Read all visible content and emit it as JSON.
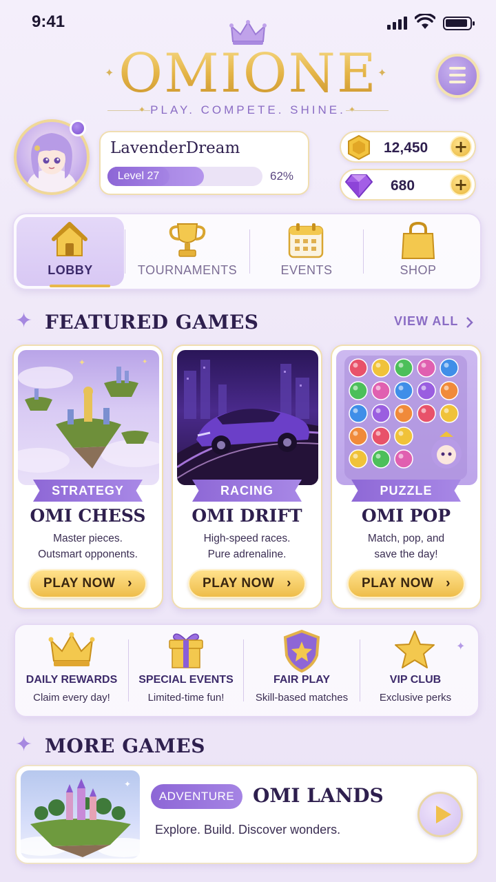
{
  "status_bar": {
    "time": "9:41"
  },
  "header": {
    "logo": "OMIONE",
    "tagline": "PLAY. COMPETE. SHINE.",
    "menu_icon": "hamburger-menu-icon"
  },
  "profile": {
    "username": "LavenderDream",
    "level_label": "Level 27",
    "progress_percent": 62,
    "progress_label": "62%"
  },
  "currency": {
    "coins": {
      "icon": "gold-coin-icon",
      "value": "12,450",
      "add": "+"
    },
    "gems": {
      "icon": "purple-gem-icon",
      "value": "680",
      "add": "+"
    }
  },
  "nav": {
    "items": [
      {
        "label": "LOBBY",
        "icon": "house-icon",
        "active": true
      },
      {
        "label": "TOURNAMENTS",
        "icon": "trophy-icon",
        "active": false
      },
      {
        "label": "EVENTS",
        "icon": "calendar-icon",
        "active": false
      },
      {
        "label": "SHOP",
        "icon": "shopping-bag-icon",
        "active": false
      }
    ]
  },
  "featured": {
    "title": "FEATURED GAMES",
    "view_all": "VIEW ALL",
    "games": [
      {
        "genre": "STRATEGY",
        "name": "OMI CHESS",
        "desc1": "Master pieces.",
        "desc2": "Outsmart opponents.",
        "cta": "PLAY NOW"
      },
      {
        "genre": "RACING",
        "name": "OMI DRIFT",
        "desc1": "High-speed races.",
        "desc2": "Pure adrenaline.",
        "cta": "PLAY NOW"
      },
      {
        "genre": "PUZZLE",
        "name": "OMI POP",
        "desc1": "Match, pop, and",
        "desc2": "save the day!",
        "cta": "PLAY NOW"
      }
    ]
  },
  "features": [
    {
      "title": "DAILY REWARDS",
      "sub": "Claim every day!",
      "icon": "crown-icon"
    },
    {
      "title": "SPECIAL EVENTS",
      "sub": "Limited-time fun!",
      "icon": "gift-icon"
    },
    {
      "title": "FAIR PLAY",
      "sub": "Skill-based matches",
      "icon": "shield-star-icon"
    },
    {
      "title": "VIP CLUB",
      "sub": "Exclusive perks",
      "icon": "star-icon"
    }
  ],
  "more_games": {
    "title": "MORE GAMES",
    "game": {
      "genre": "ADVENTURE",
      "name": "OMI LANDS",
      "desc": "Explore. Build. Discover wonders."
    }
  },
  "colors": {
    "accent_purple": "#9a78dc",
    "gold": "#e8b84a",
    "text_dark": "#2e1f4e"
  }
}
